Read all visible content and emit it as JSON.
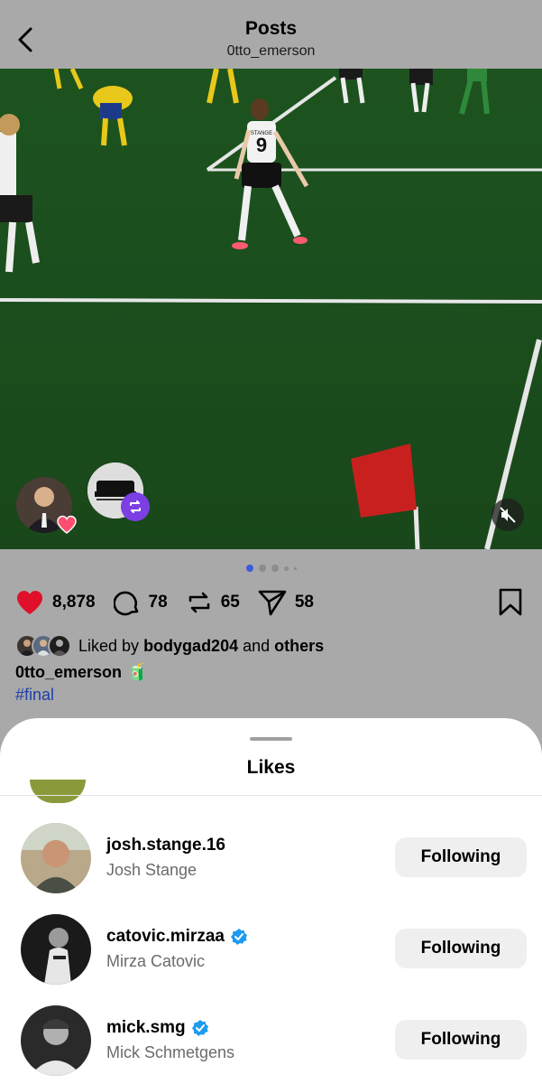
{
  "header": {
    "title": "Posts",
    "subtitle": "0tto_emerson"
  },
  "media": {
    "jersey_name": "STANGE",
    "jersey_number": "9",
    "carousel_pages": 5,
    "carousel_active": 0
  },
  "actions": {
    "likes": "8,878",
    "comments": "78",
    "reposts": "65",
    "shares": "58"
  },
  "liked_by": {
    "prefix": "Liked by",
    "user": "bodygad204",
    "and": "and",
    "others": "others"
  },
  "caption": {
    "username": "0tto_emerson",
    "emoji": "🧃",
    "hashtag": "#final"
  },
  "sheet": {
    "title": "Likes",
    "items": [
      {
        "username": "josh.stange.16",
        "full_name": "Josh Stange",
        "verified": false,
        "button": "Following"
      },
      {
        "username": "catovic.mirzaa",
        "full_name": "Mirza Catovic",
        "verified": true,
        "button": "Following"
      },
      {
        "username": "mick.smg",
        "full_name": "Mick Schmetgens",
        "verified": true,
        "button": "Following"
      }
    ]
  },
  "colors": {
    "like_red": "#e0102a",
    "link_blue": "#1e3fa8",
    "verified_blue": "#1d9bf0",
    "repost_purple": "#7b3fe4"
  }
}
